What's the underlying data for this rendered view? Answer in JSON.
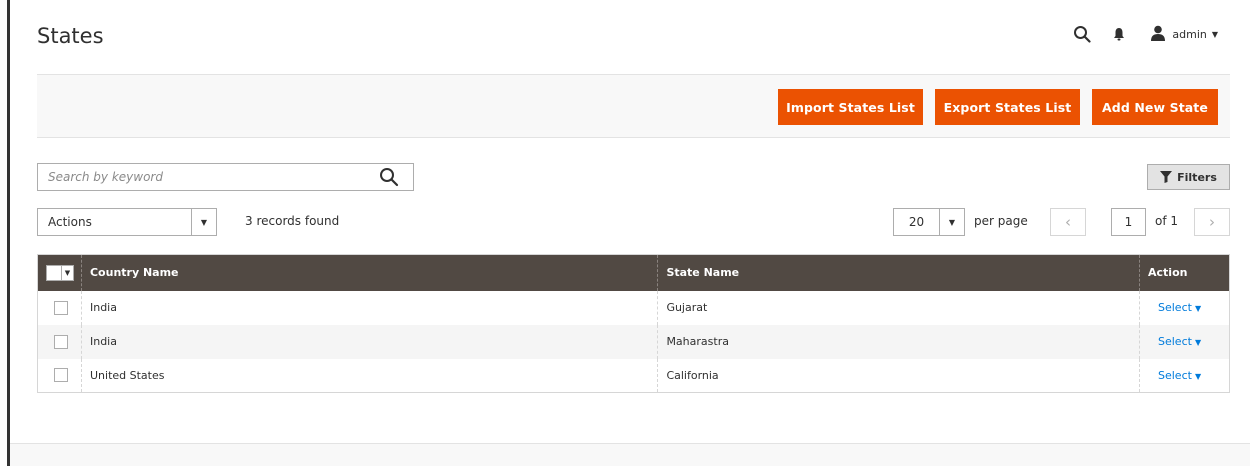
{
  "page": {
    "title": "States"
  },
  "header": {
    "user_name": "admin",
    "icons": [
      "search-icon",
      "bell-icon",
      "user-icon",
      "chevron-down-icon"
    ]
  },
  "toolbar": {
    "import_label": "Import States List",
    "export_label": "Export States List",
    "add_label": "Add New State",
    "accent": "#eb5202"
  },
  "search": {
    "placeholder": "Search by keyword",
    "value": ""
  },
  "filters": {
    "label": "Filters"
  },
  "mass_actions": {
    "label": "Actions"
  },
  "records": {
    "text": "3 records found"
  },
  "pager": {
    "per_page_value": "20",
    "per_page_label": "per page",
    "current_page": "1",
    "of_label": "of 1",
    "prev": "‹",
    "next": "›"
  },
  "grid": {
    "header_bg": "#514943",
    "columns": [
      "Country Name",
      "State Name",
      "Action"
    ],
    "rows": [
      {
        "country": "India",
        "state": "Gujarat",
        "action": "Select"
      },
      {
        "country": "India",
        "state": "Maharastra",
        "action": "Select"
      },
      {
        "country": "United States",
        "state": "California",
        "action": "Select"
      }
    ]
  }
}
